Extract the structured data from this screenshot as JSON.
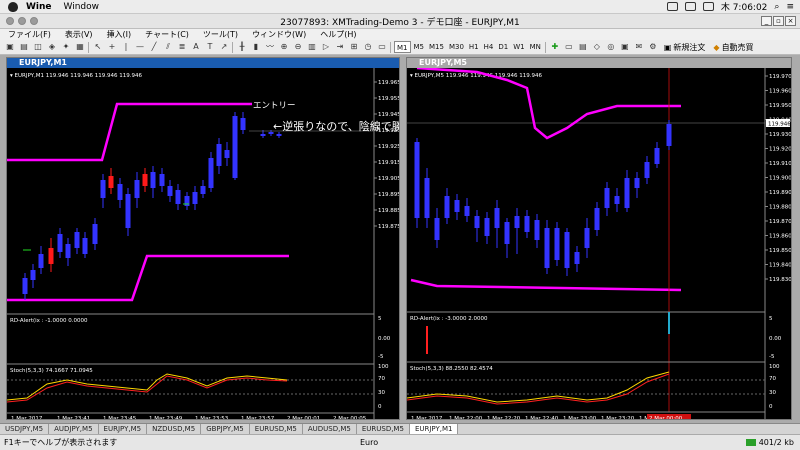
{
  "mac": {
    "app": "Wine",
    "window_menu": "Window",
    "clock": "木 7:06:02"
  },
  "window": {
    "title": "23077893: XMTrading-Demo 3 - デモ口座 - EURJPY,M1"
  },
  "menu": [
    "ファイル(F)",
    "表示(V)",
    "挿入(I)",
    "チャート(C)",
    "ツール(T)",
    "ウィンドウ(W)",
    "ヘルプ(H)"
  ],
  "toolbar": {
    "timeframes": [
      "M1",
      "M5",
      "M15",
      "M30",
      "H1",
      "H4",
      "D1",
      "W1",
      "MN"
    ],
    "active_tf": "M1",
    "new_order": "新規注文",
    "auto_trading": "自動売買"
  },
  "chart1": {
    "title": "EURJPY,M1",
    "info": "▾ EURJPY,M1  119.946  119.946  119.946  119.946",
    "price_labels": [
      "119.965",
      "119.955",
      "119.945",
      "119.935",
      "119.925",
      "119.915",
      "119.905",
      "119.895",
      "119.885",
      "119.875"
    ],
    "alert_info": "RD-Alert(ix : -1.0000 0.0000",
    "alert_scale": [
      "5",
      "0.00",
      "-5"
    ],
    "stoch_info": "Stoch(5,3,3) 74.1667 71.0945",
    "stoch_scale": [
      "100",
      "70",
      "30",
      "0"
    ],
    "time_labels": [
      "1 Mar 2017",
      "1 Mar 23:41",
      "1 Mar 23:45",
      "1 Mar 23:49",
      "1 Mar 23:53",
      "1 Mar 23:57",
      "2 Mar 00:01",
      "2 Mar 00:05"
    ],
    "entry_label": "エントリー",
    "annotation": "←逆張りなので、陰線で勝ち！"
  },
  "chart2": {
    "title": "EURJPY,M5",
    "info": "▾ EURJPY,M5  119.946  119.946  119.946  119.946",
    "price_labels": [
      "119.970",
      "119.960",
      "119.950",
      "119.940",
      "119.930",
      "119.920",
      "119.910",
      "119.900",
      "119.890",
      "119.880",
      "119.870",
      "119.860",
      "119.850",
      "119.840",
      "119.830"
    ],
    "current_price": "119.946",
    "alert_info": "RD-Alert(ix : -3.0000 2.0000",
    "alert_scale": [
      "5",
      "0.00",
      "-5"
    ],
    "stoch_info": "Stoch(5,3,3) 88.2550 82.4574",
    "stoch_scale": [
      "100",
      "70",
      "30",
      "0"
    ],
    "time_labels": [
      "1 Mar 2017",
      "1 Mar 22:00",
      "1 Mar 22:20",
      "1 Mar 22:40",
      "1 Mar 23:00",
      "1 Mar 23:20",
      "1 Mar"
    ],
    "time_highlight": "2 Mar 00:00"
  },
  "tabs": [
    "USDJPY,M5",
    "AUDJPY,M5",
    "EURJPY,M5",
    "NZDUSD,M5",
    "GBPJPY,M5",
    "EURUSD,M5",
    "AUDUSD,M5",
    "EURUSD,M5",
    "EURJPY,M1"
  ],
  "active_tab": "EURJPY,M1",
  "status": {
    "help": "F1キーでヘルプが表示されます",
    "profile": "Euro",
    "traffic": "401/2 kb"
  },
  "colors": {
    "bull": "#ff1a1a",
    "bear": "#3333ff",
    "envelope": "#ff00ff",
    "stoch_main": "#ffd700",
    "stoch_signal": "#ff2020"
  }
}
